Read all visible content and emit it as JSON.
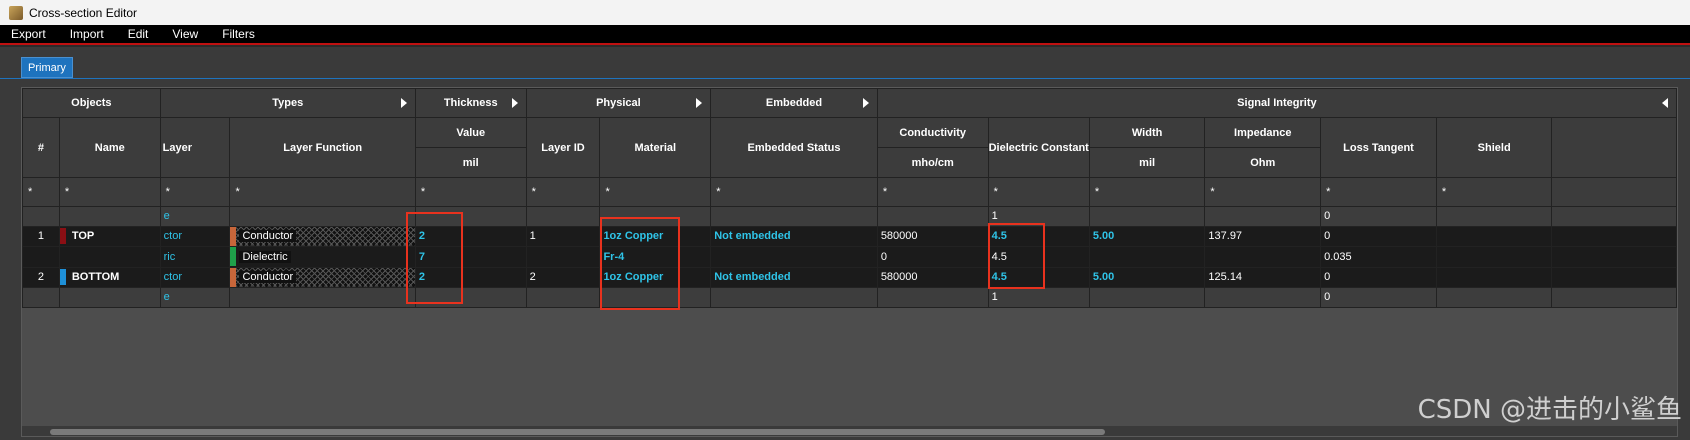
{
  "window": {
    "title": "Cross-section Editor"
  },
  "menu": [
    "Export",
    "Import",
    "Edit",
    "View",
    "Filters"
  ],
  "tabs": [
    {
      "label": "Primary",
      "active": true
    }
  ],
  "groups": {
    "objects": "Objects",
    "types": "Types",
    "thickness": "Thickness",
    "physical": "Physical",
    "embedded": "Embedded",
    "signal_integrity": "Signal Integrity"
  },
  "columns": {
    "num": "#",
    "name": "Name",
    "layer": "Layer",
    "layer_function": "Layer Function",
    "value": "Value",
    "value_unit": "mil",
    "layer_id": "Layer ID",
    "material": "Material",
    "embedded_status": "Embedded Status",
    "conductivity": "Conductivity",
    "conductivity_unit": "mho/cm",
    "dielectric_constant": "Dielectric Constant",
    "width": "Width",
    "width_unit": "mil",
    "impedance": "Impedance",
    "impedance_unit": "Ohm",
    "loss_tangent": "Loss Tangent",
    "shield": "Shield"
  },
  "filter_value": "*",
  "rows": [
    {
      "num": "",
      "name": "",
      "layer": "e",
      "function": "",
      "value": "",
      "layer_id": "",
      "material": "",
      "embedded": "",
      "conductivity": "",
      "dk": "1",
      "width": "",
      "impedance": "",
      "loss": "0",
      "shield": "",
      "kind": "surface"
    },
    {
      "num": "1",
      "name": "TOP",
      "layer": "ctor",
      "function": "Conductor",
      "value": "2",
      "layer_id": "1",
      "material": "1oz Copper",
      "embedded": "Not embedded",
      "conductivity": "580000",
      "dk": "4.5",
      "width": "5.00",
      "impedance": "137.97",
      "loss": "0",
      "shield": "",
      "kind": "conductor",
      "chip_color": "#8b0f14",
      "fn_color": "#c8663a"
    },
    {
      "num": "",
      "name": "",
      "layer": "ric",
      "function": "Dielectric",
      "value": "7",
      "layer_id": "",
      "material": "Fr-4",
      "embedded": "",
      "conductivity": "0",
      "dk": "4.5",
      "width": "",
      "impedance": "",
      "loss": "0.035",
      "shield": "",
      "kind": "dielectric",
      "fn_color": "#1fa04a"
    },
    {
      "num": "2",
      "name": "BOTTOM",
      "layer": "ctor",
      "function": "Conductor",
      "value": "2",
      "layer_id": "2",
      "material": "1oz Copper",
      "embedded": "Not embedded",
      "conductivity": "580000",
      "dk": "4.5",
      "width": "5.00",
      "impedance": "125.14",
      "loss": "0",
      "shield": "",
      "kind": "conductor",
      "chip_color": "#1e90d8",
      "fn_color": "#c8663a"
    },
    {
      "num": "",
      "name": "",
      "layer": "e",
      "function": "",
      "value": "",
      "layer_id": "",
      "material": "",
      "embedded": "",
      "conductivity": "",
      "dk": "1",
      "width": "",
      "impedance": "",
      "loss": "0",
      "shield": "",
      "kind": "surface"
    }
  ],
  "watermark": "CSDN @进击的小鲨鱼"
}
